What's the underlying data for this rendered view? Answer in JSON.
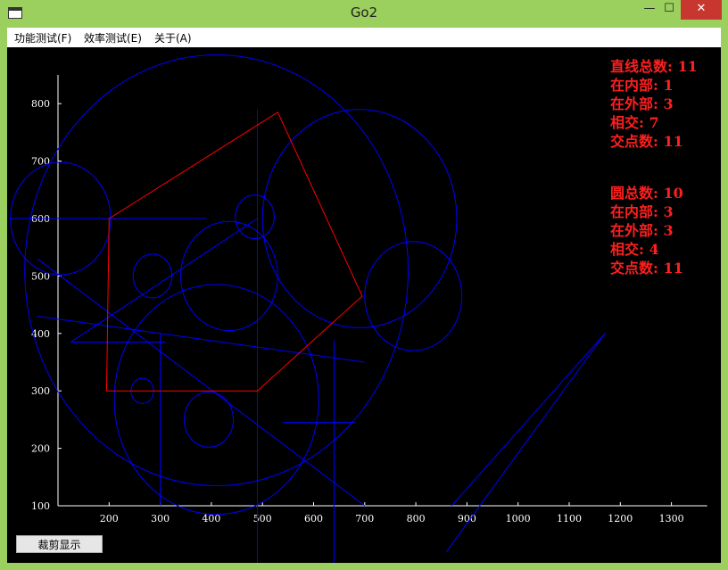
{
  "window": {
    "title": "Go2",
    "buttons": {
      "minimize": "—",
      "maximize": "☐",
      "close": "✕"
    }
  },
  "menu": [
    {
      "label": "功能测试(F)"
    },
    {
      "label": "效率测试(E)"
    },
    {
      "label": "关于(A)"
    }
  ],
  "stats": {
    "lines": [
      "直线总数: 11",
      "在内部: 1",
      "在外部: 3",
      "相交: 7",
      "交点数: 11"
    ],
    "circles": [
      "圆总数: 10",
      "在内部: 3",
      "在外部: 3",
      "相交: 4",
      "交点数: 11"
    ]
  },
  "button": {
    "label": "裁剪显示"
  },
  "colors": {
    "background": "#000000",
    "axis": "#ffffff",
    "shapes": "#0000ff",
    "polygon": "#ff0000",
    "stats_text": "#ff1f1f"
  },
  "chart_data": {
    "type": "scatter",
    "x_ticks": [
      200,
      300,
      400,
      500,
      600,
      700,
      800,
      900,
      1000,
      1100,
      1200,
      1300
    ],
    "y_ticks": [
      100,
      200,
      300,
      400,
      500,
      600,
      700,
      800
    ],
    "xlim": [
      100,
      1350
    ],
    "ylim": [
      100,
      850
    ],
    "polygon": [
      [
        200,
        600
      ],
      [
        530,
        785
      ],
      [
        695,
        465
      ],
      [
        490,
        300
      ],
      [
        195,
        300
      ]
    ],
    "circles": [
      {
        "cx": 410,
        "cy": 510,
        "r": 375
      },
      {
        "cx": 690,
        "cy": 600,
        "r": 190
      },
      {
        "cx": 105,
        "cy": 600,
        "r": 98
      },
      {
        "cx": 435,
        "cy": 500,
        "r": 95
      },
      {
        "cx": 795,
        "cy": 465,
        "r": 95
      },
      {
        "cx": 485,
        "cy": 603,
        "r": 38
      },
      {
        "cx": 285,
        "cy": 500,
        "r": 38
      },
      {
        "cx": 395,
        "cy": 250,
        "r": 48
      },
      {
        "cx": 265,
        "cy": 300,
        "r": 22
      },
      {
        "cx": 410,
        "cy": 285,
        "r": 200
      }
    ],
    "lines": [
      [
        [
          5,
          600
        ],
        [
          390,
          600
        ]
      ],
      [
        [
          490,
          790
        ],
        [
          490,
          -30
        ]
      ],
      [
        [
          60,
          530
        ],
        [
          700,
          100
        ]
      ],
      [
        [
          60,
          430
        ],
        [
          700,
          350
        ]
      ],
      [
        [
          125,
          385
        ],
        [
          310,
          385
        ]
      ],
      [
        [
          125,
          385
        ],
        [
          490,
          600
        ]
      ],
      [
        [
          300,
          400
        ],
        [
          300,
          100
        ]
      ],
      [
        [
          540,
          245
        ],
        [
          680,
          245
        ]
      ],
      [
        [
          640,
          388
        ],
        [
          640,
          -30
        ]
      ],
      [
        [
          860,
          20
        ],
        [
          1170,
          400
        ]
      ],
      [
        [
          870,
          100
        ],
        [
          1170,
          400
        ]
      ]
    ]
  }
}
